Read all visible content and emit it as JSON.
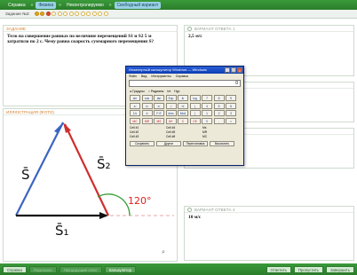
{
  "topbar": {
    "tabs": [
      "Справка",
      "Физика",
      "Неконтролируемо",
      "Свободный вариант"
    ],
    "sep": "»"
  },
  "taskbar": {
    "label": "Задание №3:"
  },
  "task": {
    "header": "ЗАДАНИЕ",
    "text": "Тело на совершение равных по величине перемещений S1 и S2 5 м затратило по 2 с. Чему равна скорость суммарного перемещения S?"
  },
  "illustration": {
    "header": "ИЛЛЮСТРАЦИЯ (Фото)",
    "labels": {
      "s": "S̄",
      "s1": "S̄₁",
      "s2": "S̄₂",
      "angle": "120°"
    },
    "colors": {
      "s": "#3b64c4",
      "s1": "#111111",
      "s2": "#cf2f2f",
      "angle": "#e02020",
      "arc": "#3ea03e"
    }
  },
  "answers": [
    {
      "header": "ВАРИАНТ ОТВЕТА 1",
      "text": "2,5 м/с"
    },
    {
      "header": "ВАРИАНТ ОТВЕТА 2",
      "text": ""
    },
    {
      "header": "ВАРИАНТ ОТВЕТА 3",
      "text": ""
    },
    {
      "header": "ВАРИАНТ ОТВЕТА 4",
      "text": "10 м/с"
    }
  ],
  "calculator": {
    "title": "Инженерный калькулятор Windows — Windows",
    "menu": [
      "Файл",
      "Вид",
      "Инструменты",
      "Справка"
    ],
    "display": "0",
    "modes": [
      "Градусы",
      "Радианы",
      "Int",
      "Hyp"
    ],
    "buttons": [
      "sin",
      "cos",
      "tan",
      "Exp",
      "ln",
      "log",
      "7",
      "8",
      "9",
      "x²",
      "x³",
      "xʸ",
      "√",
      "n!",
      "(",
      "4",
      "5",
      "6",
      "1/x",
      "π",
      "F-E",
      "dms",
      "Mod",
      ")",
      "1",
      "2",
      "3",
      "MC",
      "MR",
      "MS",
      "M+",
      "C",
      "CE",
      "0",
      ",",
      "="
    ],
    "memory": [
      "Cell #1",
      "Cell #4",
      "Ms",
      "Cell #2",
      "Cell #5",
      "MR",
      "Cell #3",
      "Cell #6",
      "MC"
    ],
    "functions": [
      "Сохранить",
      "Другое",
      "Перестановка",
      "Вычислить"
    ]
  },
  "bottombar": {
    "left": [
      "Справка",
      "Подсказка",
      "Предыдущий ответ",
      "Калькулятор"
    ],
    "right": [
      "Ответить",
      "Пропустить",
      "Завершить"
    ]
  }
}
